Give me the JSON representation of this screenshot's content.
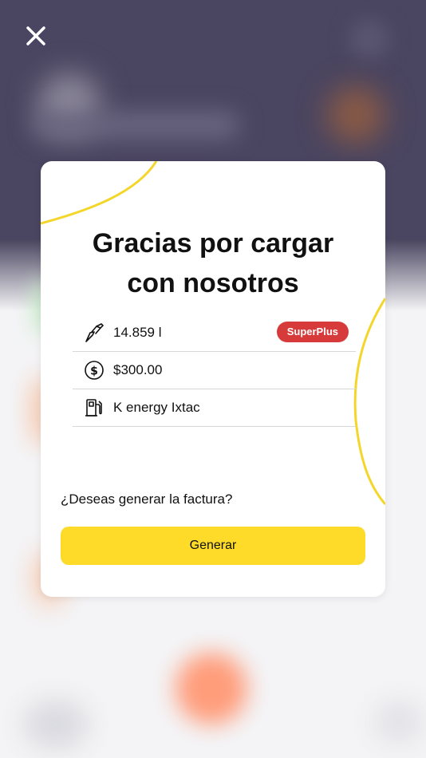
{
  "modal": {
    "title_line1": "Gracias por cargar",
    "title_line2": "con nosotros",
    "rows": [
      {
        "icon": "fuel-nozzle-icon",
        "text": "14.859 l",
        "badge": "SuperPlus"
      },
      {
        "icon": "dollar-coin-icon",
        "text": "$300.00"
      },
      {
        "icon": "gas-pump-icon",
        "text": "K energy Ixtac"
      }
    ],
    "question": "¿Deseas generar la factura?",
    "button_label": "Generar"
  },
  "close_icon": "close-icon",
  "colors": {
    "accent_yellow": "#fedb29",
    "badge_red": "#d63a3a",
    "background_header": "#4a4560"
  }
}
